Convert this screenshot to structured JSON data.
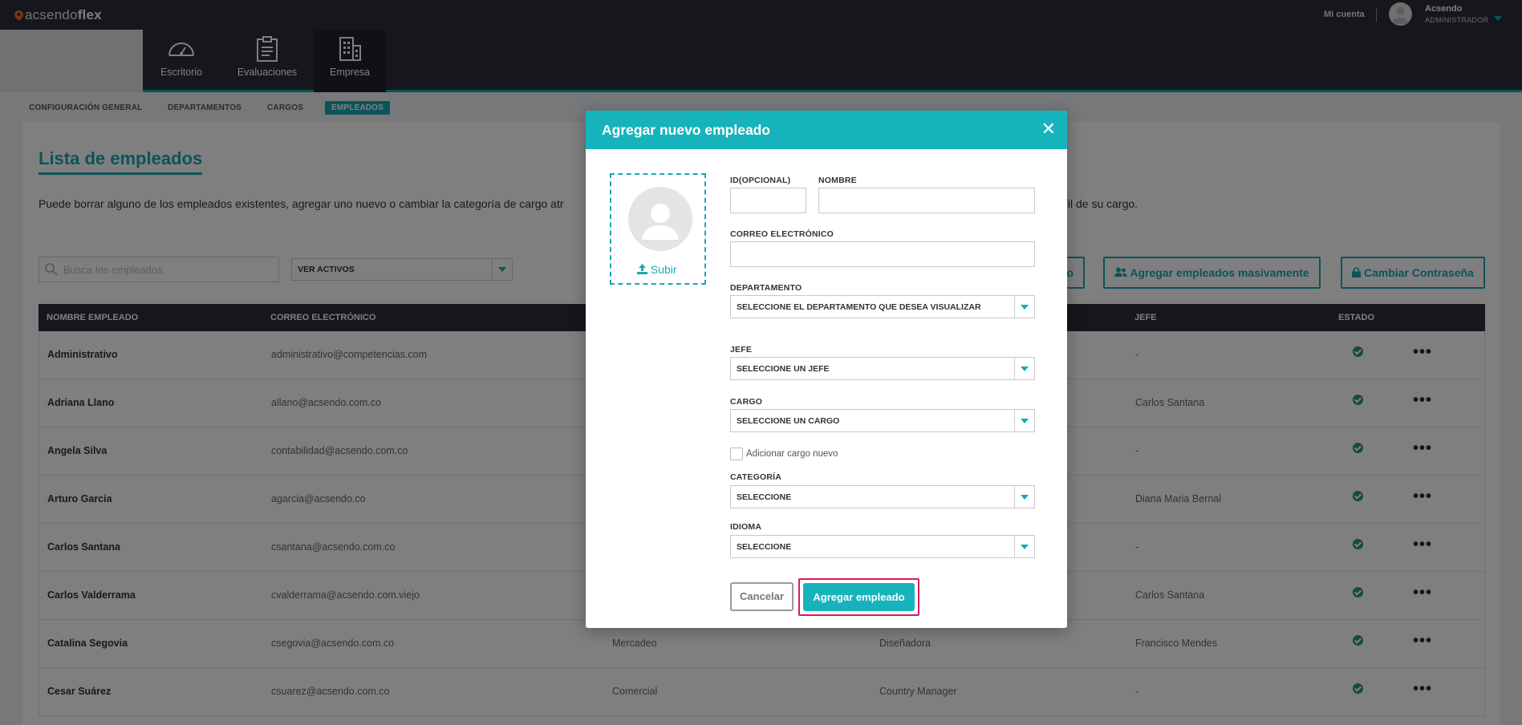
{
  "app": {
    "logo_light": "acsendo",
    "logo_bold": "flex"
  },
  "header": {
    "account_link": "Mi cuenta",
    "user_name": "Acsendo",
    "user_role": "ADMINISTRADOR"
  },
  "nav": [
    {
      "label": "Escritorio",
      "icon": "speedometer-icon"
    },
    {
      "label": "Evaluaciones",
      "icon": "clipboard-icon"
    },
    {
      "label": "Empresa",
      "icon": "building-icon",
      "active": true
    }
  ],
  "subtabs": [
    "CONFIGURACIÓN GENERAL",
    "DEPARTAMENTOS",
    "CARGOS",
    "EMPLEADOS"
  ],
  "page": {
    "title": "Lista de empleados",
    "description": "Puede borrar alguno de los empleados existentes, agregar uno nuevo o cambiar la categoría de cargo atr",
    "description_end": "fil de su cargo.",
    "search_placeholder": "Busca los empleados",
    "filter_value": "VER ACTIVOS",
    "btn_partial": "o",
    "btn_bulk": "Agregar empleados masivamente",
    "btn_password": "Cambiar Contraseña"
  },
  "table": {
    "headers": {
      "name": "NOMBRE EMPLEADO",
      "email": "CORREO ELECTRÓNICO",
      "jefe": "JEFE",
      "estado": "ESTADO"
    },
    "rows": [
      {
        "name": "Administrativo",
        "email": "administrativo@competencias.com",
        "dept": "",
        "cargo": "",
        "jefe": "-"
      },
      {
        "name": "Adriana Llano",
        "email": "allano@acsendo.com.co",
        "dept": "",
        "cargo": "",
        "jefe": "Carlos Santana"
      },
      {
        "name": "Angela Silva",
        "email": "contabilidad@acsendo.com.co",
        "dept": "",
        "cargo": "",
        "jefe": "-"
      },
      {
        "name": "Arturo Garcia",
        "email": "agarcia@acsendo.co",
        "dept": "",
        "cargo": "",
        "jefe": "Diana Maria Bernal"
      },
      {
        "name": "Carlos Santana",
        "email": "csantana@acsendo.com.co",
        "dept": "",
        "cargo": "",
        "jefe": "-"
      },
      {
        "name": "Carlos Valderrama",
        "email": "cvalderrama@acsendo.com.viejo",
        "dept": "",
        "cargo": "",
        "jefe": "Carlos Santana"
      },
      {
        "name": "Catalina Segovia",
        "email": "csegovia@acsendo.com.co",
        "dept": "Mercadeo",
        "cargo": "Diseñadora",
        "jefe": "Francisco Mendes"
      },
      {
        "name": "Cesar Suárez",
        "email": "csuarez@acsendo.com.co",
        "dept": "Comercial",
        "cargo": "Country Manager",
        "jefe": "-"
      }
    ]
  },
  "modal": {
    "title": "Agregar nuevo empleado",
    "upload_label": "Subir",
    "labels": {
      "id": "ID(OPCIONAL)",
      "nombre": "NOMBRE",
      "correo": "CORREO ELECTRÓNICO",
      "departamento": "DEPARTAMENTO",
      "jefe": "JEFE",
      "cargo": "CARGO",
      "categoria": "CATEGORÍA",
      "idioma": "IDIOMA"
    },
    "values": {
      "id": "",
      "nombre": "",
      "correo": "",
      "departamento": "SELECCIONE EL DEPARTAMENTO QUE DESEA VISUALIZAR",
      "jefe": "SELECCIONE UN JEFE",
      "cargo": "SELECCIONE UN CARGO",
      "categoria": "SELECCIONE",
      "idioma": "SELECCIONE"
    },
    "checkbox_label": "Adicionar cargo nuevo",
    "cancel_label": "Cancelar",
    "submit_label": "Agregar empleado"
  },
  "colors": {
    "accent": "#17a8b5",
    "dark": "#2b2f3a",
    "highlight": "#d81b60",
    "success": "#2a9d57"
  }
}
